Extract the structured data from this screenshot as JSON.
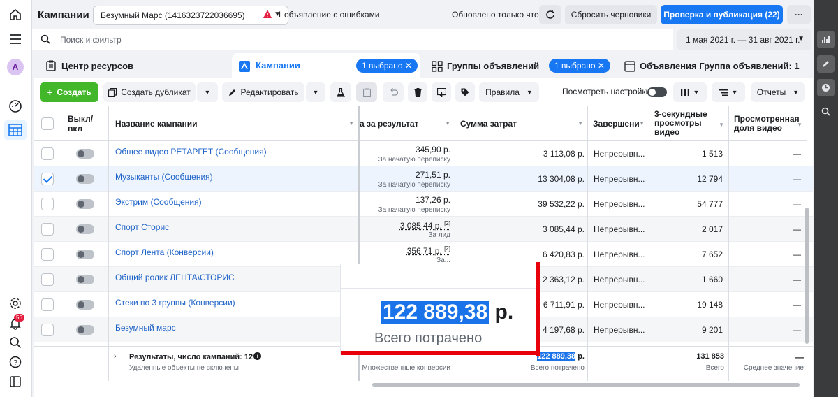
{
  "header": {
    "title": "Кампании",
    "account": "Безумный Марс (1416323722036695)",
    "error_text": "1 объявление с ошибками",
    "updated_text": "Обновлено только что",
    "reset_label": "Сбросить черновики",
    "publish_label": "Проверка и публикация (22)",
    "more_label": "···"
  },
  "search": {
    "placeholder": "Поиск и фильтр",
    "date_range": "1 мая 2021 г. — 31 авг 2021 г."
  },
  "left_rail": {
    "avatar_letter": "A",
    "notification_count": "56"
  },
  "tabs": {
    "resources": "Центр ресурсов",
    "campaigns": "Кампании",
    "campaigns_pill": "1 выбрано",
    "adsets": "Группы объявлений",
    "adsets_pill": "1 выбрано",
    "ads": "Объявления Группа объявлений: 1"
  },
  "toolbar": {
    "create": "Создать",
    "duplicate": "Создать дубликат",
    "edit": "Редактировать",
    "rules": "Правила",
    "view_settings": "Посмотреть настройки",
    "reports": "Отчеты"
  },
  "columns": {
    "onoff_1": "Выкл/",
    "onoff_2": "вкл",
    "name": "Название кампании",
    "cost_per_result": "а за результат",
    "spend": "Сумма затрат",
    "ends": "Завершени",
    "views_1": "3-секундные",
    "views_2": "просмотры",
    "views_3": "видео",
    "share_1": "Просмотренная",
    "share_2": "доля видео"
  },
  "rows": [
    {
      "name": "Общее видео РЕТАРГЕТ (Сообщения)",
      "cpr": "345,90 р.",
      "cpr_sub": "За начатую переписку",
      "spend": "3 113,08 р.",
      "ends": "Непрерывн...",
      "views": "1 513",
      "share": "—",
      "checked": false
    },
    {
      "name": "Музыканты (Сообщения)",
      "cpr": "271,51 р.",
      "cpr_sub": "За начатую переписку",
      "spend": "13 304,08 р.",
      "ends": "Непрерывн...",
      "views": "12 794",
      "share": "—",
      "checked": true
    },
    {
      "name": "Экстрим (Сообщения)",
      "cpr": "137,26 р.",
      "cpr_sub": "За начатую переписку",
      "spend": "39 532,22 р.",
      "ends": "Непрерывн...",
      "views": "54 777",
      "share": "—",
      "checked": false
    },
    {
      "name": "Спорт Сторис",
      "cpr": "3 085,44 р.",
      "cpr_sup": "[2]",
      "cpr_sub": "За лид",
      "spend": "3 085,44 р.",
      "ends": "Непрерывн...",
      "views": "2 017",
      "share": "—",
      "checked": false
    },
    {
      "name": "Спорт Лента (Конверсии)",
      "cpr": "356,71 р.",
      "cpr_sup": "[2]",
      "cpr_sub": "За...",
      "spend": "6 420,83 р.",
      "ends": "Непрерывн...",
      "views": "7 652",
      "share": "—",
      "checked": false
    },
    {
      "name": "Общий ролик ЛЕНТА\\СТОРИС",
      "cpr": "",
      "cpr_sub": "",
      "spend": "2 363,12 р.",
      "ends": "Непрерывн...",
      "views": "1 660",
      "share": "—",
      "checked": false
    },
    {
      "name": "Стеки по 3 группы (Конверсии)",
      "cpr": "",
      "cpr_sub": "",
      "spend": "6 711,91 р.",
      "ends": "Непрерывн...",
      "views": "19 148",
      "share": "—",
      "checked": false
    },
    {
      "name": "Безумный марс",
      "cpr": "",
      "cpr_sub": "",
      "spend": "4 197,68 р.",
      "ends": "Непрерывн...",
      "views": "9 201",
      "share": "—",
      "checked": false
    }
  ],
  "totals": {
    "label": "Результаты, число кампаний: 12",
    "sub": "Удаленные объекты не включены",
    "cpr_sub": "Множественные конверсии",
    "spend_value": "122 889,38",
    "spend_unit": " р.",
    "spend_sub": "Всего потрачено",
    "views": "131 853",
    "views_sub": "Всего",
    "share": "—",
    "share_sub": "Среднее значение"
  },
  "zoom": {
    "value": "122 889,38",
    "unit": " р.",
    "label": "Всего потрачено"
  },
  "colors": {
    "accent": "#1877f2",
    "create_green": "#42b72a",
    "highlight_red": "#e8000b"
  }
}
